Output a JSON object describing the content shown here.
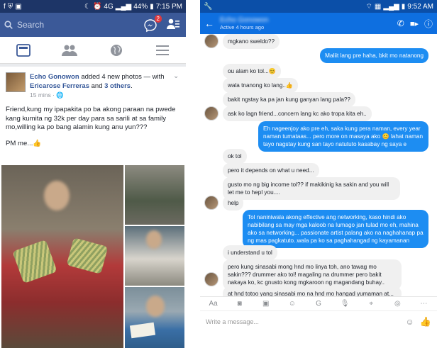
{
  "left": {
    "status": {
      "time": "7:15 PM",
      "battery": "44%",
      "network": "4G"
    },
    "search": {
      "placeholder": "Search"
    },
    "messenger_badge": "2",
    "post": {
      "author": "Echo Gonowon",
      "action": "added 4 new photos",
      "with_text": "— with",
      "tagged": "Ericarose Ferreras",
      "and_text": "and",
      "others": "3 others",
      "time": "15 mins",
      "body": "Friend,kung my ipapakita po ba akong paraan na pwede kang kumita ng 32k per day para sa sarili at sa family mo,willing ka po bang alamin kung anu yun???",
      "pm": "PM me..."
    }
  },
  "right": {
    "status": {
      "time": "9:52 AM"
    },
    "contact": {
      "name": "Echo Gonowon",
      "active": "Active 4 hours ago"
    },
    "messages": [
      {
        "from": "in",
        "text": "mgkano sweldo??"
      },
      {
        "from": "out",
        "text": "Maliit lang pre haha, bkit mo natanong"
      },
      {
        "from": "in",
        "text": "ou alam ko tol...😊"
      },
      {
        "from": "in",
        "text": "wala tnanong ko lang..👍"
      },
      {
        "from": "in",
        "text": "bakit ngstay ka pa jan kung ganyan lang pala??"
      },
      {
        "from": "in",
        "text": "ask ko lagn friend...concern lang kc ako tropa kita eh.."
      },
      {
        "from": "out",
        "text": "Eh nageenjoy ako pre eh, saka kung pera naman, every year naman tumataas... pero more on masaya ako 😊 lahat naman tayo nagstay kung san tayo natututo kasabay ng saya e"
      },
      {
        "from": "in",
        "text": "ok tol"
      },
      {
        "from": "in",
        "text": "pero it depends on what u need..."
      },
      {
        "from": "in",
        "text": "gusto mo ng big income tol?? if makikinig ka sakin and you will let me to hepl you...."
      },
      {
        "from": "in",
        "text": "help"
      },
      {
        "from": "out",
        "text": "Tol naniniwala akong effective ang networking, kaso hindi ako nabibilang sa may mga kaloob na lumago jan tulad mo eh, mahina ako sa networking... passionate artist palang ako na naghahanap pa ng mas pagkatuto..wala pa ko sa paghahangad ng kayamanan"
      },
      {
        "from": "in",
        "text": "i understand u tol"
      },
      {
        "from": "in",
        "text": "pero kung sinasabi mong hnd mo linya toh, ano tawag mo sakin??? drummer ako tol! magaling na drummer pero bakit nakaya ko, kc gnusto kong mgkaroon ng magandang buhay.."
      },
      {
        "from": "in",
        "text": "at hnd totoo yang sinasabi mo na hnd mo hangad yumaman at..."
      }
    ],
    "composer": {
      "placeholder": "Write a message..."
    }
  }
}
